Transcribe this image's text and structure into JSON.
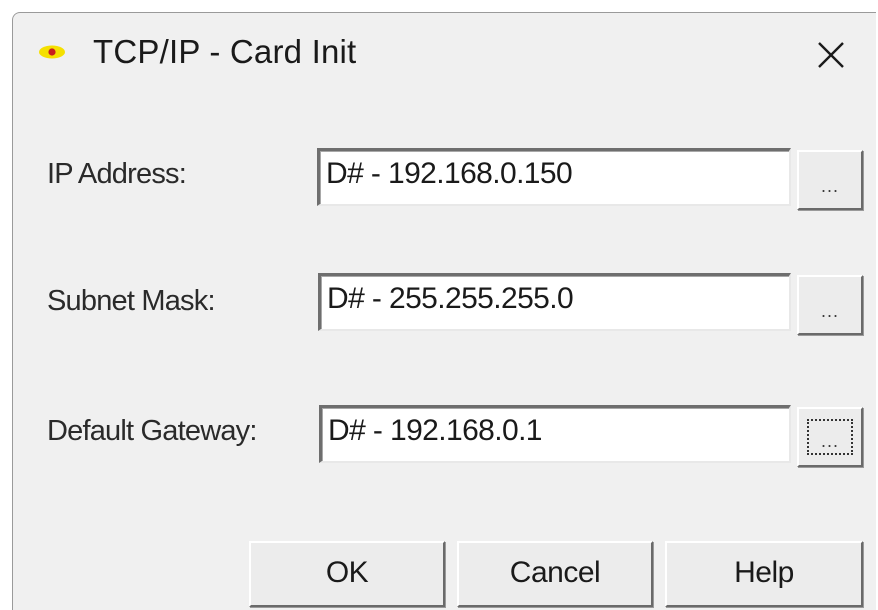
{
  "window": {
    "title": "TCP/IP - Card Init",
    "icon": "app-dot-icon",
    "close_icon": "close-icon"
  },
  "fields": [
    {
      "label": "IP Address:",
      "value": "D# - 192.168.0.150",
      "browse_label": "..."
    },
    {
      "label": "Subnet Mask:",
      "value": "D# - 255.255.255.0",
      "browse_label": "..."
    },
    {
      "label": "Default Gateway:",
      "value": "D# - 192.168.0.1",
      "browse_label": "..."
    }
  ],
  "buttons": {
    "ok": "OK",
    "cancel": "Cancel",
    "help": "Help"
  },
  "colors": {
    "dialog_bg": "#f0f0f0",
    "icon_yellow": "#f5e000",
    "icon_red": "#c81e1e"
  }
}
